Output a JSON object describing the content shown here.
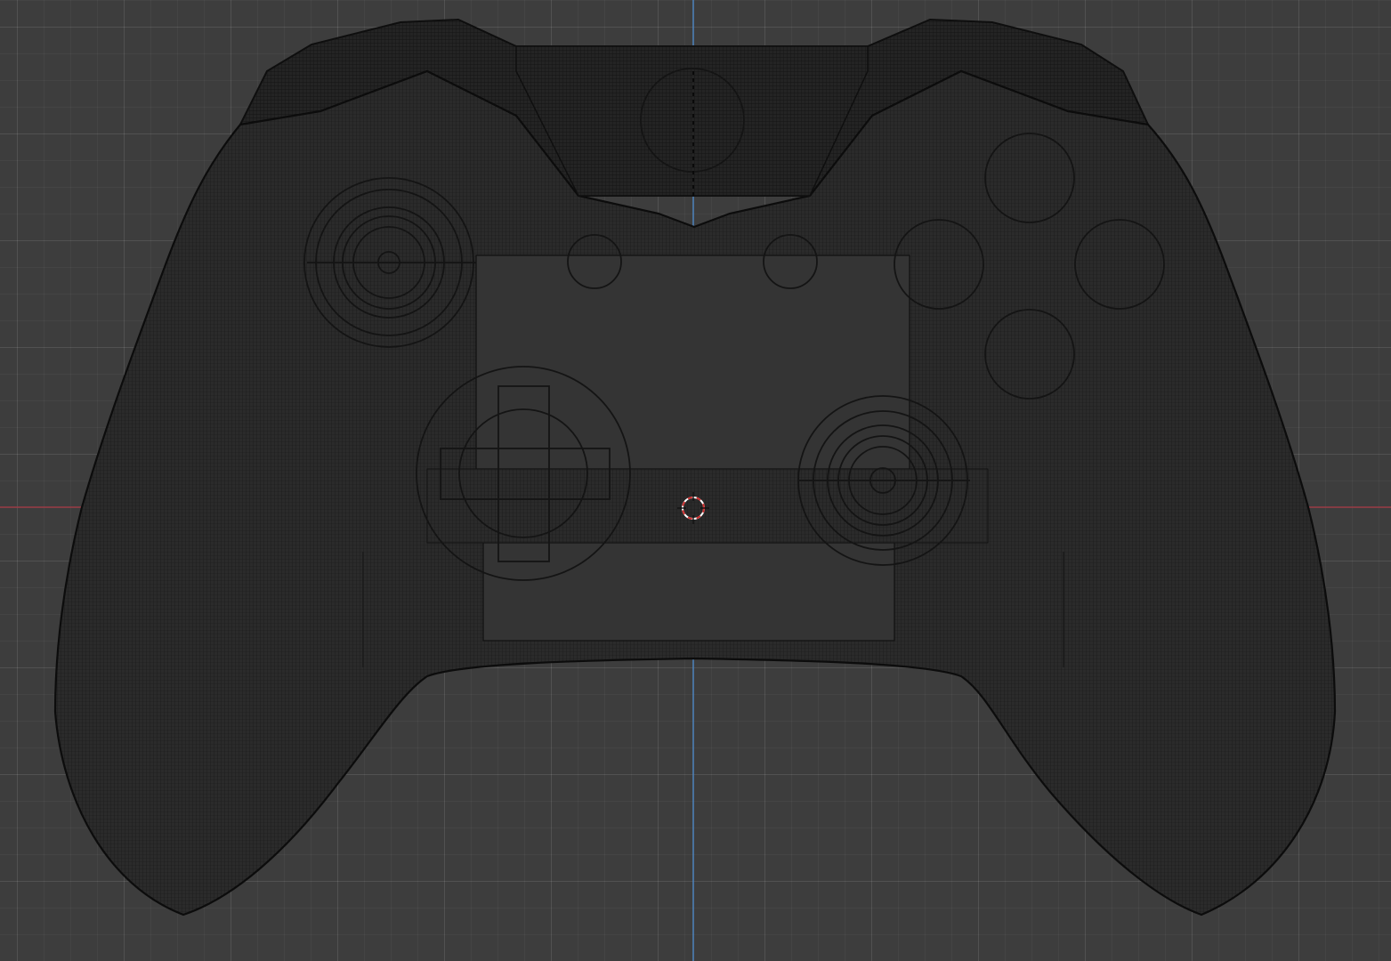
{
  "viewport": {
    "mode": "orthographic-front",
    "shading": "wireframe",
    "background_color": "#3d3d3d",
    "grid_color": "#4a4a4a",
    "axis_x_color": "#9a3b45",
    "axis_z_color": "#4f88c6",
    "cursor_color": "#d03030"
  },
  "model": {
    "name": "gamepad-controller",
    "body_color": "#2a2a2a",
    "wire_color": "#121212",
    "components": [
      "body",
      "bumper-bar",
      "left-thumbstick",
      "right-thumbstick",
      "d-pad",
      "face-buttons",
      "view-button",
      "menu-button",
      "home-button"
    ]
  }
}
